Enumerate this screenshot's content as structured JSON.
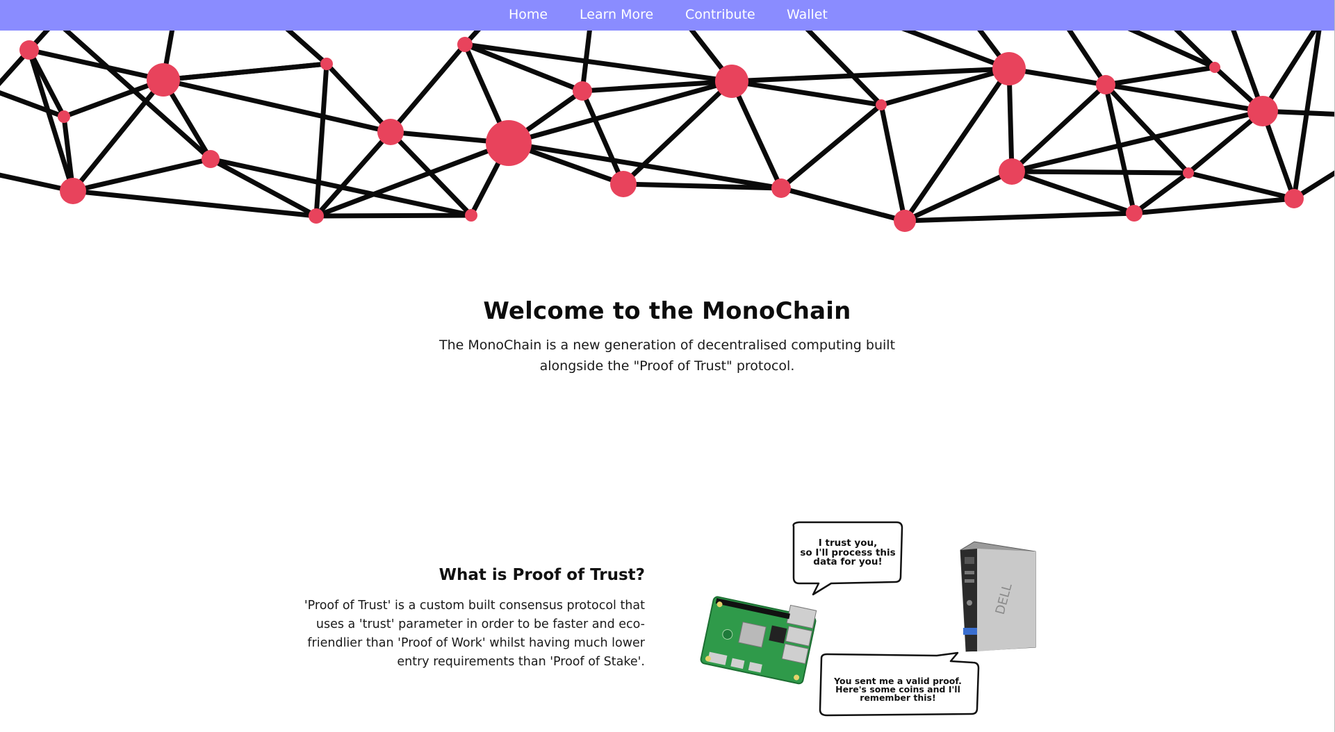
{
  "nav": {
    "links": [
      {
        "label": "Home"
      },
      {
        "label": "Learn More"
      },
      {
        "label": "Contribute"
      },
      {
        "label": "Wallet"
      }
    ],
    "background": "#8a8cff",
    "text_color": "#ffffff"
  },
  "banner": {
    "node_color": "#e8435c",
    "edge_color": "#0a0a0a"
  },
  "hero": {
    "title": "Welcome to the MonoChain",
    "description": "The MonoChain is a new generation of decentralised computing built alongside the \"Proof of Trust\" protocol."
  },
  "proof_of_trust": {
    "title": "What is Proof of Trust?",
    "description": "'Proof of Trust' is a custom built consensus protocol that uses a 'trust' parameter in order to be faster and eco-friendlier than 'Proof of Work' whilst having much lower entry requirements than 'Proof of Stake'.",
    "illustration": {
      "bubble_top_lines": [
        "I trust you,",
        "so I'll process this",
        "data for you!"
      ],
      "bubble_bottom_lines": [
        "You sent me a valid proof.",
        "Here's some coins and I'll",
        "remember this!"
      ],
      "pc_brand": "DELL"
    }
  }
}
